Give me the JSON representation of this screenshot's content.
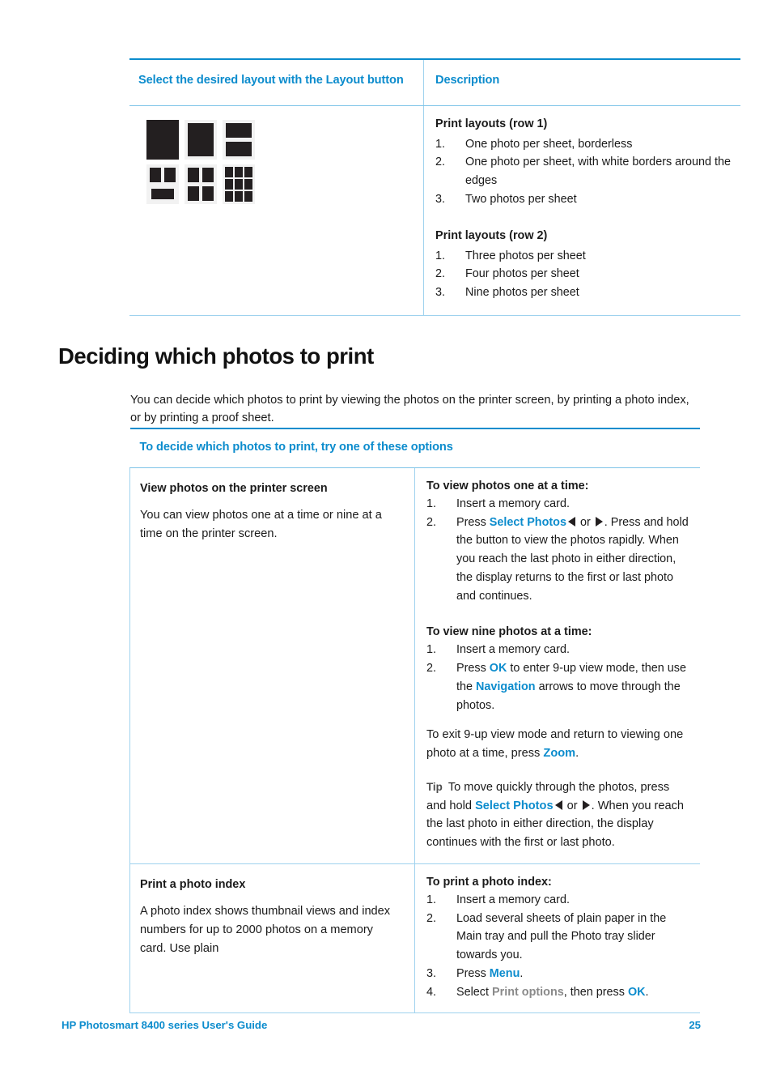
{
  "document": {
    "title": "HP Photosmart 8400 series User's Guide",
    "page_number": "25",
    "accent_color": "#0c8ccd",
    "rule_color": "#9fd2ee"
  },
  "layout_table": {
    "header_left": "Select the desired layout with the Layout button",
    "header_right": "Description",
    "icons": [
      {
        "name": "layout-icon-one-borderless",
        "label": "One photo per sheet, borderless"
      },
      {
        "name": "layout-icon-one-bordered",
        "label": "One photo per sheet, with white borders"
      },
      {
        "name": "layout-icon-two-up",
        "label": "Two photos per sheet"
      },
      {
        "name": "layout-icon-three-up",
        "label": "Three photos per sheet"
      },
      {
        "name": "layout-icon-four-up",
        "label": "Four photos per sheet"
      },
      {
        "name": "layout-icon-nine-up",
        "label": "Nine photos per sheet"
      }
    ],
    "row1_heading": "Print layouts (row 1)",
    "row1_items": [
      {
        "num": "1.",
        "text": "One photo per sheet, borderless"
      },
      {
        "num": "2.",
        "text": "One photo per sheet, with white borders around the edges"
      },
      {
        "num": "3.",
        "text": "Two photos per sheet"
      }
    ],
    "row2_heading": "Print layouts (row 2)",
    "row2_items": [
      {
        "num": "1.",
        "text": "Three photos per sheet"
      },
      {
        "num": "2.",
        "text": "Four photos per sheet"
      },
      {
        "num": "3.",
        "text": "Nine photos per sheet"
      }
    ]
  },
  "section": {
    "heading": "Deciding which photos to print",
    "intro": "You can decide which photos to print by viewing the photos on the printer screen, by printing a photo index, or by printing a proof sheet."
  },
  "options_table": {
    "header": "To decide which photos to print, try one of these options",
    "row_view": {
      "left_heading": "View photos on the printer screen",
      "left_body": "You can view photos one at a time or nine at a time on the printer screen.",
      "right_heading_1": "To view photos one at a time:",
      "step1_num": "1.",
      "step1_text": "Insert a memory card.",
      "step2_num": "2.",
      "step2_prefix": "Press ",
      "step2_bold": "Select Photos",
      "step2_mid": " or ",
      "step2_suffix": ". Press and hold the button to view the photos rapidly. When you reach the last photo in either direction, the display returns to the first or last photo and continues.",
      "right_heading_2": "To view nine photos at a time:",
      "nine_step1_num": "1.",
      "nine_step1_text": "Insert a memory card.",
      "nine_step2_num": "2.",
      "nine_step2_prefix": "Press ",
      "nine_step2_bold_ok": "OK",
      "nine_step2_mid": " to enter 9-up view mode, then use the ",
      "nine_step2_bold_nav": "Navigation",
      "nine_step2_suffix": " arrows to move through the photos.",
      "exit_prefix": "To exit 9-up view mode and return to viewing one photo at a time, press ",
      "exit_bold": "Zoom",
      "exit_suffix": ".",
      "tip_label": "Tip",
      "tip_prefix": "To move quickly through the photos, press and hold ",
      "tip_bold": "Select Photos",
      "tip_mid": " or ",
      "tip_suffix": ". When you reach the last photo in either direction, the display continues with the first or last photo."
    },
    "row_index": {
      "left_heading": "Print a photo index",
      "left_body": "A photo index shows thumbnail views and index numbers for up to 2000 photos on a memory card. Use plain",
      "right_heading": "To print a photo index:",
      "steps": [
        {
          "num": "1.",
          "text": "Insert a memory card."
        },
        {
          "num": "2.",
          "text": "Load several sheets of plain paper in the Main tray and pull the Photo tray slider towards you."
        }
      ],
      "step3_num": "3.",
      "step3_prefix": "Press ",
      "step3_bold": "Menu",
      "step3_suffix": ".",
      "step4_num": "4.",
      "step4_prefix": "Select ",
      "step4_grey": "Print options",
      "step4_mid": ", then press ",
      "step4_bold": "OK",
      "step4_suffix": "."
    }
  }
}
